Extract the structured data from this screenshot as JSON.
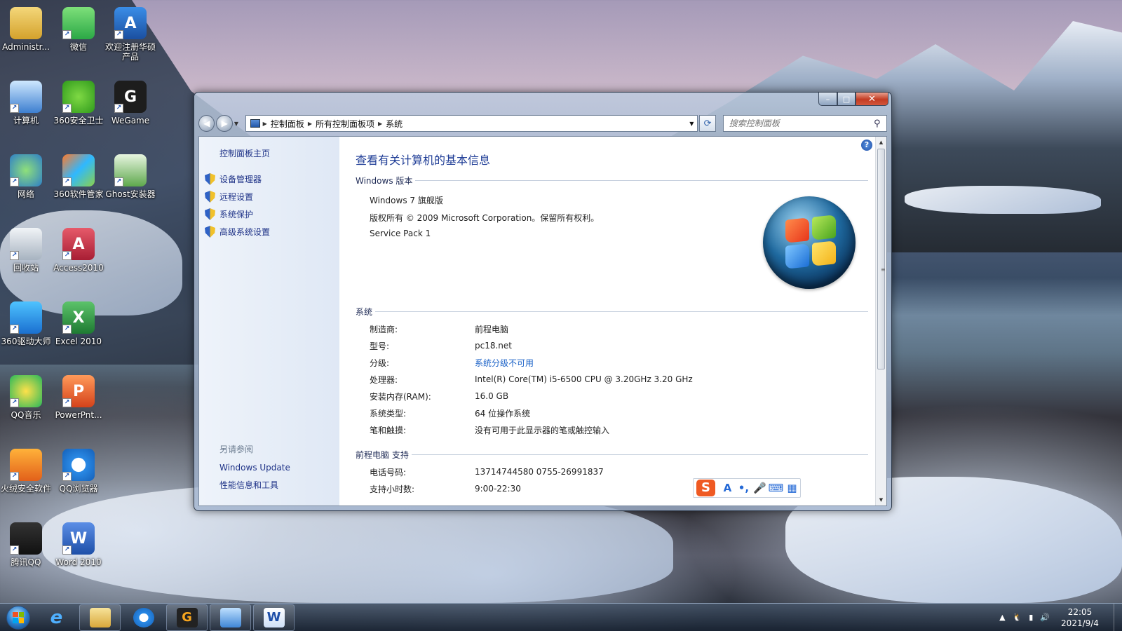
{
  "desktop": {
    "icons": [
      {
        "label": "Administr...",
        "icon": "user-folder-icon"
      },
      {
        "label": "微信",
        "icon": "wechat-icon"
      },
      {
        "label": "欢迎注册华硕产品",
        "icon": "asus-icon"
      },
      {
        "label": "计算机",
        "icon": "computer-icon"
      },
      {
        "label": "360安全卫士",
        "icon": "360-security-icon"
      },
      {
        "label": "WeGame",
        "icon": "wegame-icon"
      },
      {
        "label": "网络",
        "icon": "network-icon"
      },
      {
        "label": "360软件管家",
        "icon": "360-software-icon"
      },
      {
        "label": "Ghost安装器",
        "icon": "ghost-installer-icon"
      },
      {
        "label": "回收站",
        "icon": "recycle-bin-icon"
      },
      {
        "label": "Access2010",
        "icon": "access-icon"
      },
      {
        "label": "360驱动大师",
        "icon": "360-driver-icon"
      },
      {
        "label": "Excel 2010",
        "icon": "excel-icon"
      },
      {
        "label": "QQ音乐",
        "icon": "qq-music-icon"
      },
      {
        "label": "PowerPnt...",
        "icon": "powerpoint-icon"
      },
      {
        "label": "火绒安全软件",
        "icon": "huorong-icon"
      },
      {
        "label": "QQ浏览器",
        "icon": "qq-browser-icon"
      },
      {
        "label": "腾讯QQ",
        "icon": "qq-icon"
      },
      {
        "label": "Word 2010",
        "icon": "word-icon"
      }
    ]
  },
  "window": {
    "caption": {
      "min": "–",
      "max": "□",
      "close": "✕"
    },
    "nav": {
      "back": "◀",
      "forward": "▶"
    },
    "breadcrumb": [
      "控制面板",
      "所有控制面板项",
      "系统"
    ],
    "search_placeholder": "搜索控制面板",
    "left": {
      "home": "控制面板主页",
      "links": [
        "设备管理器",
        "远程设置",
        "系统保护",
        "高级系统设置"
      ],
      "see_also": "另请参阅",
      "bottom_links": [
        "Windows Update",
        "性能信息和工具"
      ]
    },
    "title": "查看有关计算机的基本信息",
    "edition_section": "Windows 版本",
    "edition": [
      "Windows 7 旗舰版",
      "版权所有 © 2009 Microsoft Corporation。保留所有权利。",
      "Service Pack 1"
    ],
    "system_section": "系统",
    "system_rows": [
      {
        "k": "制造商:",
        "v": "前程电脑"
      },
      {
        "k": "型号:",
        "v": "pc18.net"
      },
      {
        "k": "分级:",
        "v": "系统分级不可用"
      },
      {
        "k": "处理器:",
        "v": "Intel(R) Core(TM) i5-6500 CPU @ 3.20GHz   3.20 GHz"
      },
      {
        "k": "安装内存(RAM):",
        "v": "16.0 GB"
      },
      {
        "k": "系统类型:",
        "v": "64 位操作系统"
      },
      {
        "k": "笔和触摸:",
        "v": "没有可用于此显示器的笔或触控输入"
      }
    ],
    "support_section": "前程电脑 支持",
    "support_rows": [
      {
        "k": "电话号码:",
        "v": "13714744580 0755-26991837"
      },
      {
        "k": "支持小时数:",
        "v": "9:00-22:30"
      }
    ]
  },
  "ime": {
    "logo": "S",
    "items": [
      "A",
      "•,",
      "🎤",
      "⌨",
      "▦"
    ]
  },
  "taskbar": {
    "clock_time": "22:05",
    "clock_date": "2021/9/4"
  }
}
